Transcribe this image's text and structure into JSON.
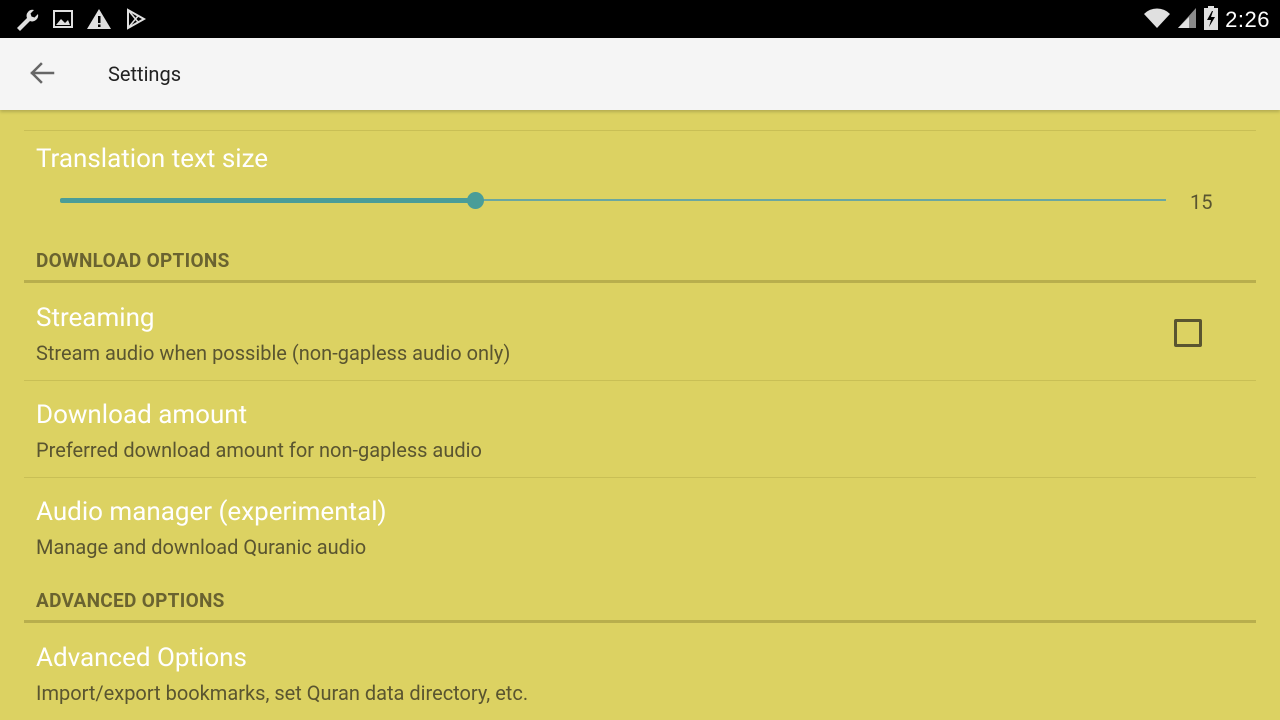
{
  "statusbar": {
    "time": "2:26",
    "icons_left": [
      "wrench-icon",
      "image-icon",
      "warning-icon",
      "play-store-icon"
    ],
    "icons_right": [
      "wifi-icon",
      "signal-icon",
      "battery-icon"
    ]
  },
  "appbar": {
    "title": "Settings",
    "back_icon": "arrow-back-icon"
  },
  "colors": {
    "background": "#dcd262",
    "accent": "#4a9d98",
    "appbar": "#f5f5f5",
    "statusbar": "#000000"
  },
  "prefs": {
    "translation_size": {
      "title": "Translation text size",
      "value": "15",
      "slider_fraction": 0.375
    },
    "download_header": "DOWNLOAD OPTIONS",
    "streaming": {
      "title": "Streaming",
      "summary": "Stream audio when possible (non-gapless audio only)",
      "checked": false
    },
    "download_amount": {
      "title": "Download amount",
      "summary": "Preferred download amount for non-gapless audio"
    },
    "audio_manager": {
      "title": "Audio manager (experimental)",
      "summary": "Manage and download Quranic audio"
    },
    "advanced_header": "ADVANCED OPTIONS",
    "advanced": {
      "title": "Advanced Options",
      "summary": "Import/export bookmarks, set Quran data directory, etc."
    }
  }
}
